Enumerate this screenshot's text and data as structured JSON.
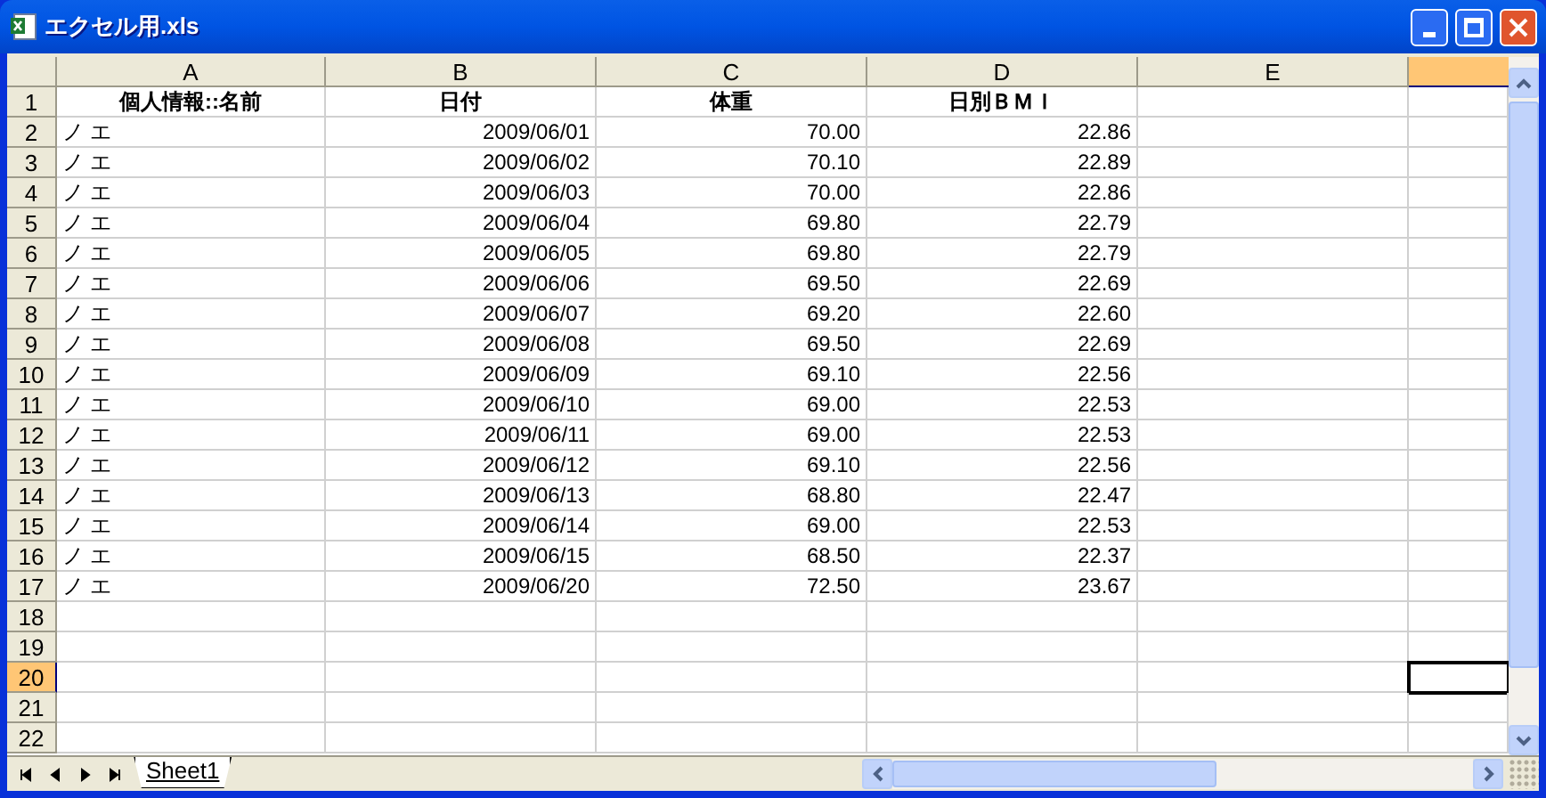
{
  "window": {
    "title": "エクセル用.xls"
  },
  "columns": [
    {
      "label": "A",
      "selected": false
    },
    {
      "label": "B",
      "selected": false
    },
    {
      "label": "C",
      "selected": false
    },
    {
      "label": "D",
      "selected": false
    },
    {
      "label": "E",
      "selected": false
    }
  ],
  "cut_column": {
    "selected": true
  },
  "header_row": {
    "number": "1",
    "selected": false,
    "cells": [
      "個人情報::名前",
      "日付",
      "体重",
      "日別ＢＭＩ"
    ]
  },
  "rows": [
    {
      "number": "2",
      "selected": false,
      "name": "ノ エ",
      "date": "2009/06/01",
      "weight": "70.00",
      "bmi": "22.86"
    },
    {
      "number": "3",
      "selected": false,
      "name": "ノ エ",
      "date": "2009/06/02",
      "weight": "70.10",
      "bmi": "22.89"
    },
    {
      "number": "4",
      "selected": false,
      "name": "ノ エ",
      "date": "2009/06/03",
      "weight": "70.00",
      "bmi": "22.86"
    },
    {
      "number": "5",
      "selected": false,
      "name": "ノ エ",
      "date": "2009/06/04",
      "weight": "69.80",
      "bmi": "22.79"
    },
    {
      "number": "6",
      "selected": false,
      "name": "ノ エ",
      "date": "2009/06/05",
      "weight": "69.80",
      "bmi": "22.79"
    },
    {
      "number": "7",
      "selected": false,
      "name": "ノ エ",
      "date": "2009/06/06",
      "weight": "69.50",
      "bmi": "22.69"
    },
    {
      "number": "8",
      "selected": false,
      "name": "ノ エ",
      "date": "2009/06/07",
      "weight": "69.20",
      "bmi": "22.60"
    },
    {
      "number": "9",
      "selected": false,
      "name": "ノ エ",
      "date": "2009/06/08",
      "weight": "69.50",
      "bmi": "22.69"
    },
    {
      "number": "10",
      "selected": false,
      "name": "ノ エ",
      "date": "2009/06/09",
      "weight": "69.10",
      "bmi": "22.56"
    },
    {
      "number": "11",
      "selected": false,
      "name": "ノ エ",
      "date": "2009/06/10",
      "weight": "69.00",
      "bmi": "22.53"
    },
    {
      "number": "12",
      "selected": false,
      "name": "ノ エ",
      "date": "2009/06/11",
      "weight": "69.00",
      "bmi": "22.53"
    },
    {
      "number": "13",
      "selected": false,
      "name": "ノ エ",
      "date": "2009/06/12",
      "weight": "69.10",
      "bmi": "22.56"
    },
    {
      "number": "14",
      "selected": false,
      "name": "ノ エ",
      "date": "2009/06/13",
      "weight": "68.80",
      "bmi": "22.47"
    },
    {
      "number": "15",
      "selected": false,
      "name": "ノ エ",
      "date": "2009/06/14",
      "weight": "69.00",
      "bmi": "22.53"
    },
    {
      "number": "16",
      "selected": false,
      "name": "ノ エ",
      "date": "2009/06/15",
      "weight": "68.50",
      "bmi": "22.37"
    },
    {
      "number": "17",
      "selected": false,
      "name": "ノ エ",
      "date": "2009/06/20",
      "weight": "72.50",
      "bmi": "23.67"
    },
    {
      "number": "18",
      "selected": false
    },
    {
      "number": "19",
      "selected": false
    },
    {
      "number": "20",
      "selected": true
    },
    {
      "number": "21",
      "selected": false
    },
    {
      "number": "22",
      "selected": false
    }
  ],
  "sheet_tabs": [
    {
      "label": "Sheet1",
      "selected": true
    }
  ]
}
